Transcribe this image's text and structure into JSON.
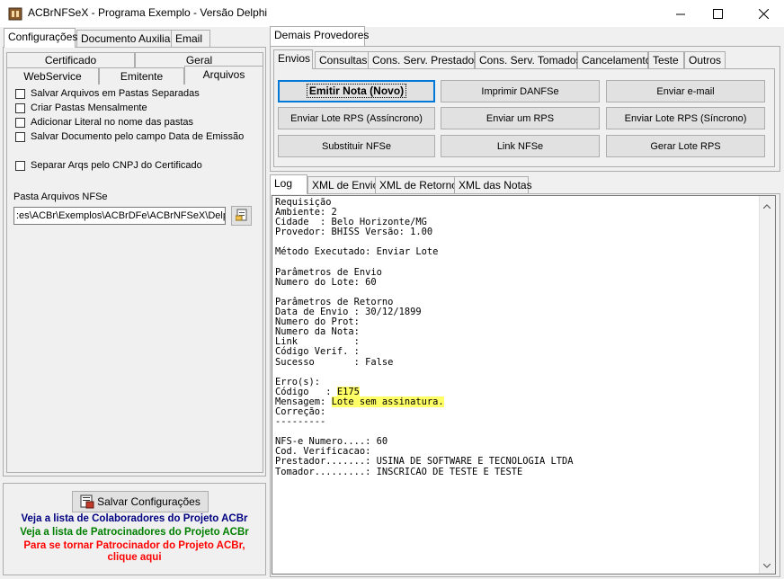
{
  "window": {
    "title": "ACBrNFSeX - Programa Exemplo - Versão Delphi",
    "minimize_glyph": "—",
    "maximize_glyph": "☐",
    "close_glyph": "✕"
  },
  "left": {
    "tabs": [
      "Configurações",
      "Documento Auxiliar",
      "Email"
    ],
    "subtabs_row1": [
      "Certificado",
      "Geral"
    ],
    "subtabs_row2": [
      "WebService",
      "Emitente",
      "Arquivos"
    ],
    "checkboxes": [
      "Salvar Arquivos em Pastas Separadas",
      "Criar Pastas Mensalmente",
      "Adicionar Literal no nome das pastas",
      "Salvar Documento pelo campo Data de Emissão",
      "Separar Arqs pelo CNPJ do Certificado"
    ],
    "pasta_label": "Pasta Arquivos NFSe",
    "pasta_value": ":es\\ACBr\\Exemplos\\ACBrDFe\\ACBrNFSeX\\Delphi",
    "save_button": "Salvar Configurações",
    "links": {
      "colaboradores": "Veja a lista de Colaboradores do Projeto ACBr",
      "patrocinadores": "Veja a lista de Patrocinadores do Projeto ACBr",
      "tornar_line1": "Para se tornar Patrocinador do Projeto ACBr,",
      "tornar_line2": "clique aqui"
    },
    "colors": {
      "colaboradores": "#000080",
      "patrocinadores": "#008000",
      "tornar": "#ff0000"
    }
  },
  "right": {
    "top_tab": "Demais Provedores",
    "tabs": [
      "Envios",
      "Consultas",
      "Cons. Serv. Prestados",
      "Cons. Serv. Tomados",
      "Cancelamento",
      "Teste",
      "Outros"
    ],
    "buttons": [
      [
        "Emitir Nota (Novo)",
        "Imprimir DANFSe",
        "Enviar e-mail"
      ],
      [
        "Enviar Lote RPS (Assíncrono)",
        "Enviar um RPS",
        "Enviar Lote RPS (Síncrono)"
      ],
      [
        "Substituir NFSe",
        "Link NFSe",
        "Gerar Lote RPS"
      ]
    ],
    "log_tabs": [
      "Log",
      "XML de Envio",
      "XML de Retorno",
      "XML das Notas"
    ],
    "log_before": "Requisição\nAmbiente: 2\nCidade  : Belo Horizonte/MG\nProvedor: BHISS Versão: 1.00\n\nMétodo Executado: Enviar Lote\n\nParâmetros de Envio\nNumero do Lote: 60\n\nParâmetros de Retorno\nData de Envio : 30/12/1899\nNumero do Prot:\nNumero da Nota:\nLink          :\nCódigo Verif. :\nSucesso       : False\n\nErro(s):\nCódigo   : ",
    "log_code": "E175",
    "log_mid": "\nMensagem: ",
    "log_msg": "Lote sem assinatura.",
    "log_after": "\nCorreção:\n---------\n\nNFS-e Numero....: 60\nCod. Verificacao:\nPrestador.......: USINA DE SOFTWARE E TECNOLOGIA LTDA\nTomador.........: INSCRICAO DE TESTE E TESTE"
  }
}
